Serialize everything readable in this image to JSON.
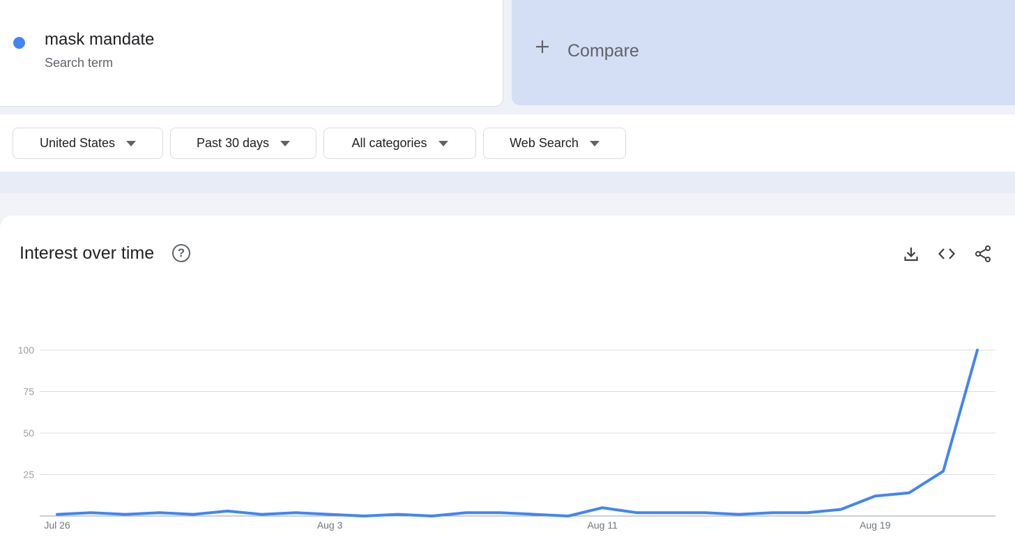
{
  "search_term": {
    "name": "mask mandate",
    "type": "Search term",
    "color": "#4285f4"
  },
  "compare": {
    "label": "Compare",
    "icon": "plus-icon"
  },
  "filters": [
    {
      "label": "United States",
      "icon": "caret-down-icon"
    },
    {
      "label": "Past 30 days",
      "icon": "caret-down-icon"
    },
    {
      "label": "All categories",
      "icon": "caret-down-icon"
    },
    {
      "label": "Web Search",
      "icon": "caret-down-icon"
    }
  ],
  "chart_panel": {
    "title": "Interest over time",
    "help_icon": "help-circle-icon",
    "actions": [
      "download-icon",
      "embed-code-icon",
      "share-icon"
    ]
  },
  "chart_data": {
    "type": "line",
    "title": "",
    "xlabel": "",
    "ylabel": "",
    "ylim": [
      0,
      100
    ],
    "yticks": [
      25,
      50,
      75,
      100
    ],
    "xtick_labels": [
      {
        "label": "Jul 26",
        "index": 0
      },
      {
        "label": "Aug 3",
        "index": 8
      },
      {
        "label": "Aug 11",
        "index": 16
      },
      {
        "label": "Aug 19",
        "index": 24
      }
    ],
    "grid": true,
    "series": [
      {
        "name": "mask mandate",
        "color": "#4285f4",
        "x": [
          "Jul 26",
          "Jul 27",
          "Jul 28",
          "Jul 29",
          "Jul 30",
          "Jul 31",
          "Aug 1",
          "Aug 2",
          "Aug 3",
          "Aug 4",
          "Aug 5",
          "Aug 6",
          "Aug 7",
          "Aug 8",
          "Aug 9",
          "Aug 10",
          "Aug 11",
          "Aug 12",
          "Aug 13",
          "Aug 14",
          "Aug 15",
          "Aug 16",
          "Aug 17",
          "Aug 18",
          "Aug 19",
          "Aug 20",
          "Aug 21",
          "Aug 22"
        ],
        "values": [
          1,
          2,
          1,
          2,
          1,
          3,
          1,
          2,
          1,
          0,
          1,
          0,
          2,
          2,
          1,
          0,
          5,
          2,
          2,
          2,
          1,
          2,
          2,
          4,
          12,
          14,
          27,
          100
        ]
      }
    ]
  }
}
